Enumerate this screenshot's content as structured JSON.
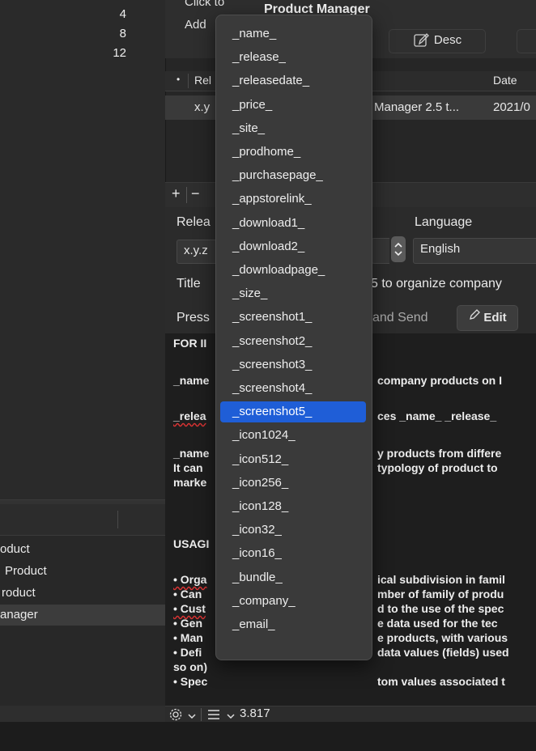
{
  "sidebar": {
    "counts": [
      "4",
      "8",
      "12"
    ],
    "items": [
      {
        "label": "oduct"
      },
      {
        "label": "Product"
      },
      {
        "label": "roduct"
      },
      {
        "label": "anager"
      }
    ]
  },
  "header": {
    "click_line1": "Click to",
    "click_line2": "Add",
    "title": "Product Manager",
    "desc_button": "Desc"
  },
  "table": {
    "columns": [
      "Rel",
      "Date"
    ],
    "rows": [
      {
        "release": "x.y",
        "title": "Manager 2.5 t...",
        "date": "2021/0"
      }
    ]
  },
  "toolbar": {
    "add": "+",
    "remove": "−"
  },
  "form": {
    "release_label": "Relea",
    "release_value": "x.y.z",
    "language_label": "Language",
    "language_value": "English",
    "title_label": "Title",
    "title_value": "5 to organize company",
    "press_label": "Press",
    "send_label": "and Send",
    "edit_label": "Edit"
  },
  "text": {
    "line1": "FOR II",
    "line2a": "_name",
    "line2b": "company products on I",
    "line3a": "_relea",
    "line3b": "ces _name_ _release_",
    "line4a": "_name",
    "line4b": "y products from differe",
    "line5a": "It can",
    "line5b": "typology of product to",
    "line6a": "marke",
    "usage": "USAGI",
    "b1a": "• Orga",
    "b1b": "ical subdivision in famil",
    "b2a": "• Can",
    "b2b": "mber of family of produ",
    "b3a": "• Cust",
    "b3b": "d to the use of the spec",
    "b4a": "• Gen",
    "b4b": "e data used for the tec",
    "b5a": "• Man",
    "b5b": "e products, with various",
    "b6a": "• Defi",
    "b6b": "data values (fields) used",
    "b7a": "so on)",
    "b8a": "• Spec",
    "b8b": "tom values associated t"
  },
  "bottom": {
    "version": "3.817"
  },
  "menu": {
    "selected_index": 14,
    "items": [
      "_name_",
      "_release_",
      "_releasedate_",
      "_price_",
      "_site_",
      "_prodhome_",
      "_purchasepage_",
      "_appstorelink_",
      "_download1_",
      "_download2_",
      "_downloadpage_",
      "_size_",
      "_screenshot1_",
      "_screenshot2_",
      "_screenshot3_",
      "_screenshot4_",
      "_screenshot5_",
      "_icon1024_",
      "_icon512_",
      "_icon256_",
      "_icon128_",
      "_icon32_",
      "_icon16_",
      "_bundle_",
      "_company_",
      "_email_"
    ]
  },
  "colors": {
    "accent": "#1f5ed7",
    "menu_bg": "#3a3a3a",
    "window_bg": "#262626"
  },
  "icons": [
    "pencil-icon",
    "gear-icon",
    "list-icon",
    "chevron-down-icon",
    "stepper-icon"
  ]
}
